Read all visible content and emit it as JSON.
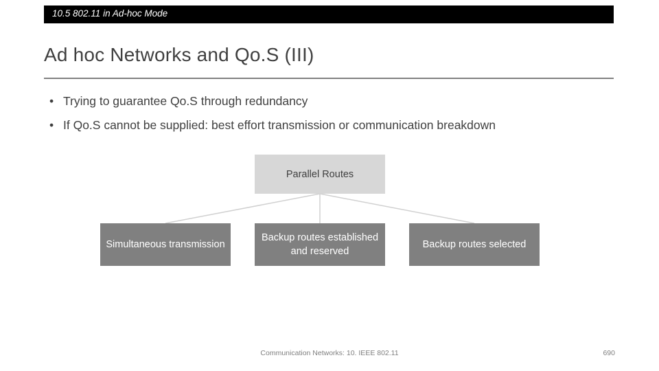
{
  "header": {
    "label": "10.5 802.11 in Ad-hoc Mode"
  },
  "title": "Ad hoc Networks and Qo.S (III)",
  "bullets": [
    {
      "marker": "•",
      "text": "Trying to guarantee Qo.S through redundancy"
    },
    {
      "marker": "•",
      "text": "If Qo.S cannot be supplied: best effort transmission or communication breakdown"
    }
  ],
  "diagram": {
    "root": "Parallel Routes",
    "children": [
      "Simultaneous transmission",
      "Backup routes established and reserved",
      "Backup routes selected"
    ]
  },
  "footer": {
    "center": "Communication Networks: 10. IEEE 802.11",
    "page": "690"
  },
  "colors": {
    "header_bg": "#000000",
    "header_fg": "#ffffff",
    "title_fg": "#3f3f3f",
    "rule": "#808080",
    "node_root_bg": "#d7d7d7",
    "node_child_bg": "#808080",
    "footer_fg": "#7f7f7f"
  }
}
